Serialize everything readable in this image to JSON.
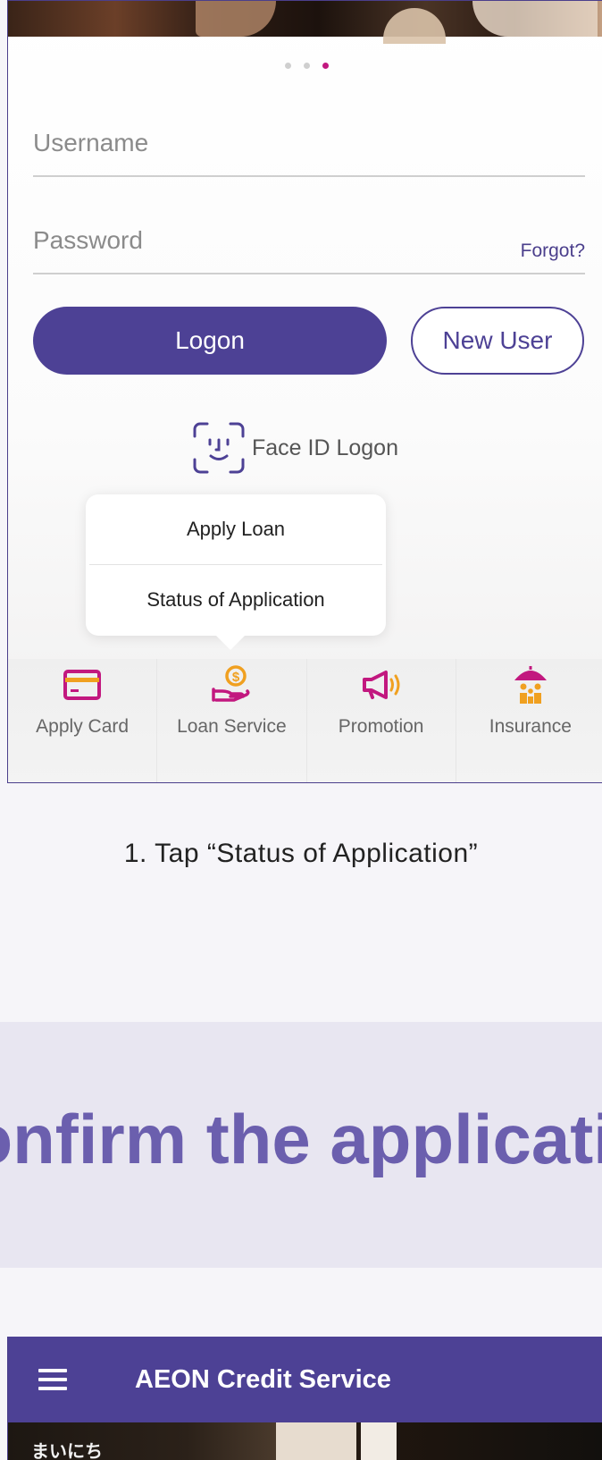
{
  "login_screen": {
    "carousel": {
      "dot_count": 3,
      "active_index": 2
    },
    "username": {
      "placeholder": "Username",
      "value": ""
    },
    "password": {
      "placeholder": "Password",
      "value": ""
    },
    "forgot_label": "Forgot?",
    "logon_label": "Logon",
    "new_user_label": "New User",
    "face_id_label": "Face ID Logon",
    "loan_menu": {
      "items": [
        "Apply Loan",
        "Status of Application"
      ]
    },
    "bottom_tabs": [
      {
        "label": "Apply Card",
        "icon": "credit-card-icon",
        "color": "#c2187f"
      },
      {
        "label": "Loan Service",
        "icon": "coin-hand-icon",
        "color": "#c2187f"
      },
      {
        "label": "Promotion",
        "icon": "megaphone-icon",
        "color": "#c2187f"
      },
      {
        "label": "Insurance",
        "icon": "umbrella-family-icon",
        "color": "#c2187f"
      }
    ]
  },
  "caption": "1. Tap “Status of Application”",
  "section_heading": "How to confirm the application status",
  "second_screen": {
    "menu_icon": "hamburger-icon",
    "title": "AEON Credit Service",
    "banner_text": "まいにち"
  },
  "colors": {
    "brand_purple": "#4d4195",
    "accent_magenta": "#c2187f",
    "icon_gold": "#f0a020",
    "heading_purple": "#6b5fae",
    "band_background": "#e8e6f1"
  }
}
